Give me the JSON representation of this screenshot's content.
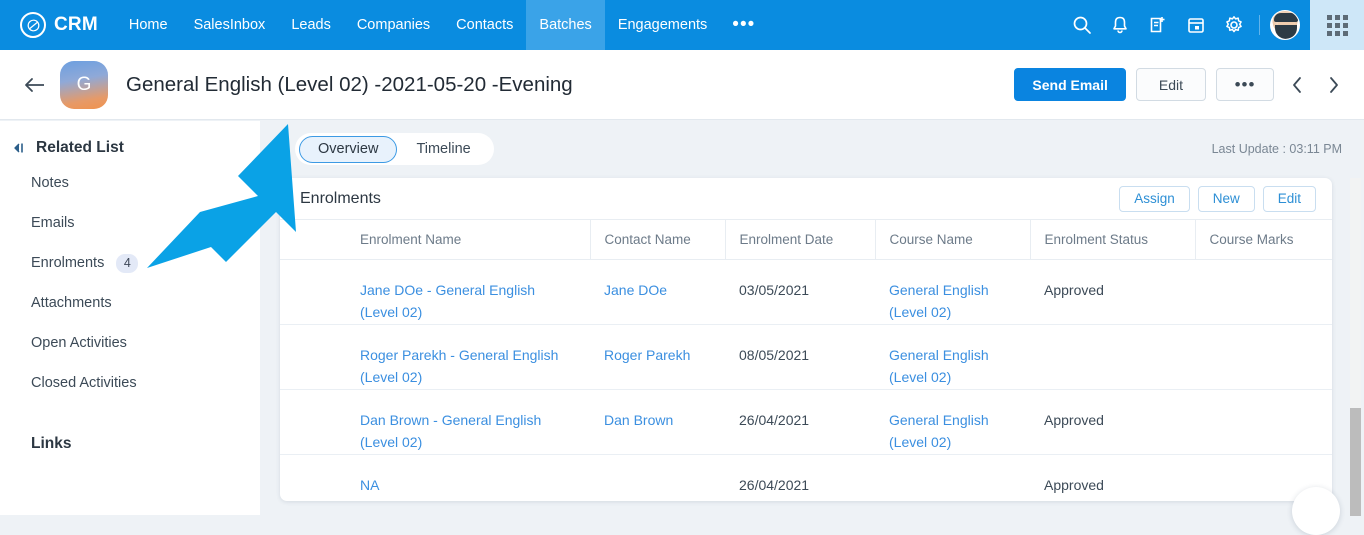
{
  "topnav": {
    "brand": "CRM",
    "brand_icon": "crm-logo-icon",
    "items": [
      {
        "label": "Home",
        "active": false
      },
      {
        "label": "SalesInbox",
        "active": false
      },
      {
        "label": "Leads",
        "active": false
      },
      {
        "label": "Companies",
        "active": false
      },
      {
        "label": "Contacts",
        "active": false
      },
      {
        "label": "Batches",
        "active": true
      },
      {
        "label": "Engagements",
        "active": false
      }
    ],
    "more_label": "•••",
    "icons": [
      "search-icon",
      "bell-icon",
      "note-add-icon",
      "calendar-icon",
      "gear-icon"
    ],
    "apps_icon": "apps-grid-icon",
    "accent_color": "#0a8ce0",
    "active_tab_color": "#3aa3e8"
  },
  "record": {
    "back_icon": "back-arrow-icon",
    "avatar_letter": "G",
    "title": "General English (Level 02) -2021-05-20 -Evening",
    "send_email_label": "Send Email",
    "edit_label": "Edit",
    "more_label": "•••",
    "prev_icon": "chevron-left-icon",
    "next_icon": "chevron-right-icon"
  },
  "sidebar": {
    "collapse_icon": "collapse-panel-icon",
    "title": "Related List",
    "items": [
      {
        "label": "Notes",
        "badge": ""
      },
      {
        "label": "Emails",
        "badge": ""
      },
      {
        "label": "Enrolments",
        "badge": "4"
      },
      {
        "label": "Attachments",
        "badge": ""
      },
      {
        "label": "Open Activities",
        "badge": ""
      },
      {
        "label": "Closed Activities",
        "badge": ""
      }
    ],
    "links_title": "Links"
  },
  "tabs": [
    {
      "label": "Overview",
      "active": true
    },
    {
      "label": "Timeline",
      "active": false
    }
  ],
  "last_update": "Last Update : 03:11 PM",
  "card": {
    "title": "Enrolments",
    "buttons": [
      {
        "label": "Assign"
      },
      {
        "label": "New"
      },
      {
        "label": "Edit"
      }
    ],
    "columns": [
      "Enrolment Name",
      "Contact Name",
      "Enrolment Date",
      "Course Name",
      "Enrolment Status",
      "Course Marks"
    ],
    "rows": [
      {
        "enrolment_name": "Jane DOe - General English (Level 02)",
        "contact_name": "Jane DOe",
        "enrolment_date": "03/05/2021",
        "course_name": "General English (Level 02)",
        "enrolment_status": "Approved",
        "course_marks": ""
      },
      {
        "enrolment_name": "Roger Parekh - General English (Level 02)",
        "contact_name": "Roger Parekh",
        "enrolment_date": "08/05/2021",
        "course_name": "General English (Level 02)",
        "enrolment_status": "",
        "course_marks": ""
      },
      {
        "enrolment_name": "Dan Brown - General English (Level 02)",
        "contact_name": "Dan Brown",
        "enrolment_date": "26/04/2021",
        "course_name": "General English (Level 02)",
        "enrolment_status": "Approved",
        "course_marks": ""
      },
      {
        "enrolment_name": "NA",
        "contact_name": "",
        "enrolment_date": "26/04/2021",
        "course_name": "",
        "enrolment_status": "Approved",
        "course_marks": ""
      }
    ]
  },
  "annotation": {
    "arrow_icon": "annotation-arrow-icon",
    "arrow_color": "#0aa2e6"
  }
}
